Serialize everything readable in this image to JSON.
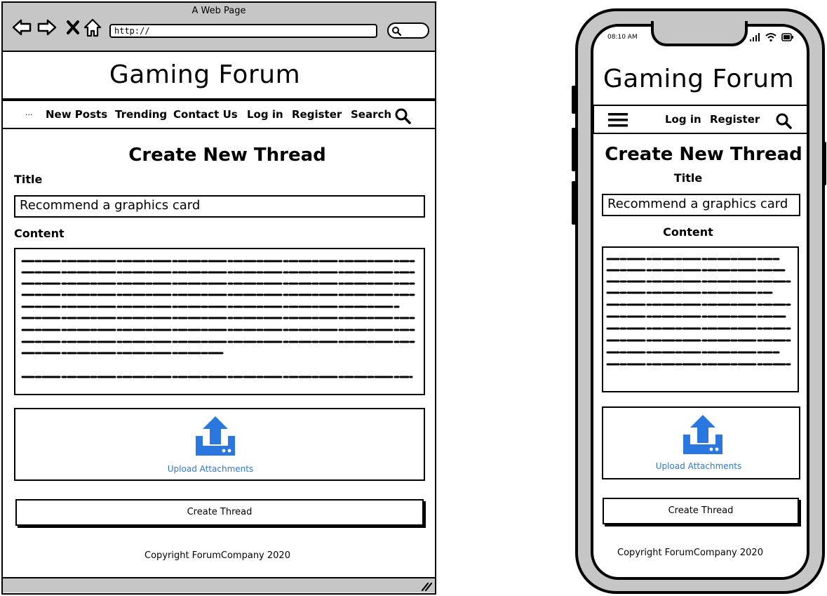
{
  "browser": {
    "window_title": "A Web Page",
    "url": "http://",
    "site_title": "Gaming Forum",
    "nav": {
      "more": "...",
      "items": [
        "New Posts",
        "Trending",
        "Contact Us",
        "Log in",
        "Register",
        "Search"
      ]
    },
    "page_title": "Create New Thread",
    "title_label": "Title",
    "title_value": "Recommend a graphics card",
    "content_label": "Content",
    "upload_label": "Upload Attachments",
    "submit_label": "Create Thread",
    "footer": "Copyright ForumCompany 2020"
  },
  "phone": {
    "status_time": "08:10 AM",
    "site_title": "Gaming Forum",
    "nav": {
      "items": [
        "Log in",
        "Register"
      ]
    },
    "page_title": "Create New Thread",
    "title_label": "Title",
    "title_value": "Recommend a graphics card",
    "content_label": "Content",
    "upload_label": "Upload Attachments",
    "submit_label": "Create Thread",
    "footer": "Copyright ForumCompany 2020"
  },
  "colors": {
    "accent": "#2b77e0",
    "chrome": "#c6c6c6",
    "ink": "#000000"
  },
  "icons": [
    "back-icon",
    "forward-icon",
    "close-icon",
    "home-icon",
    "search-icon",
    "hamburger-icon",
    "upload-icon",
    "signal-icon",
    "wifi-icon",
    "battery-icon",
    "resize-grip-icon"
  ]
}
